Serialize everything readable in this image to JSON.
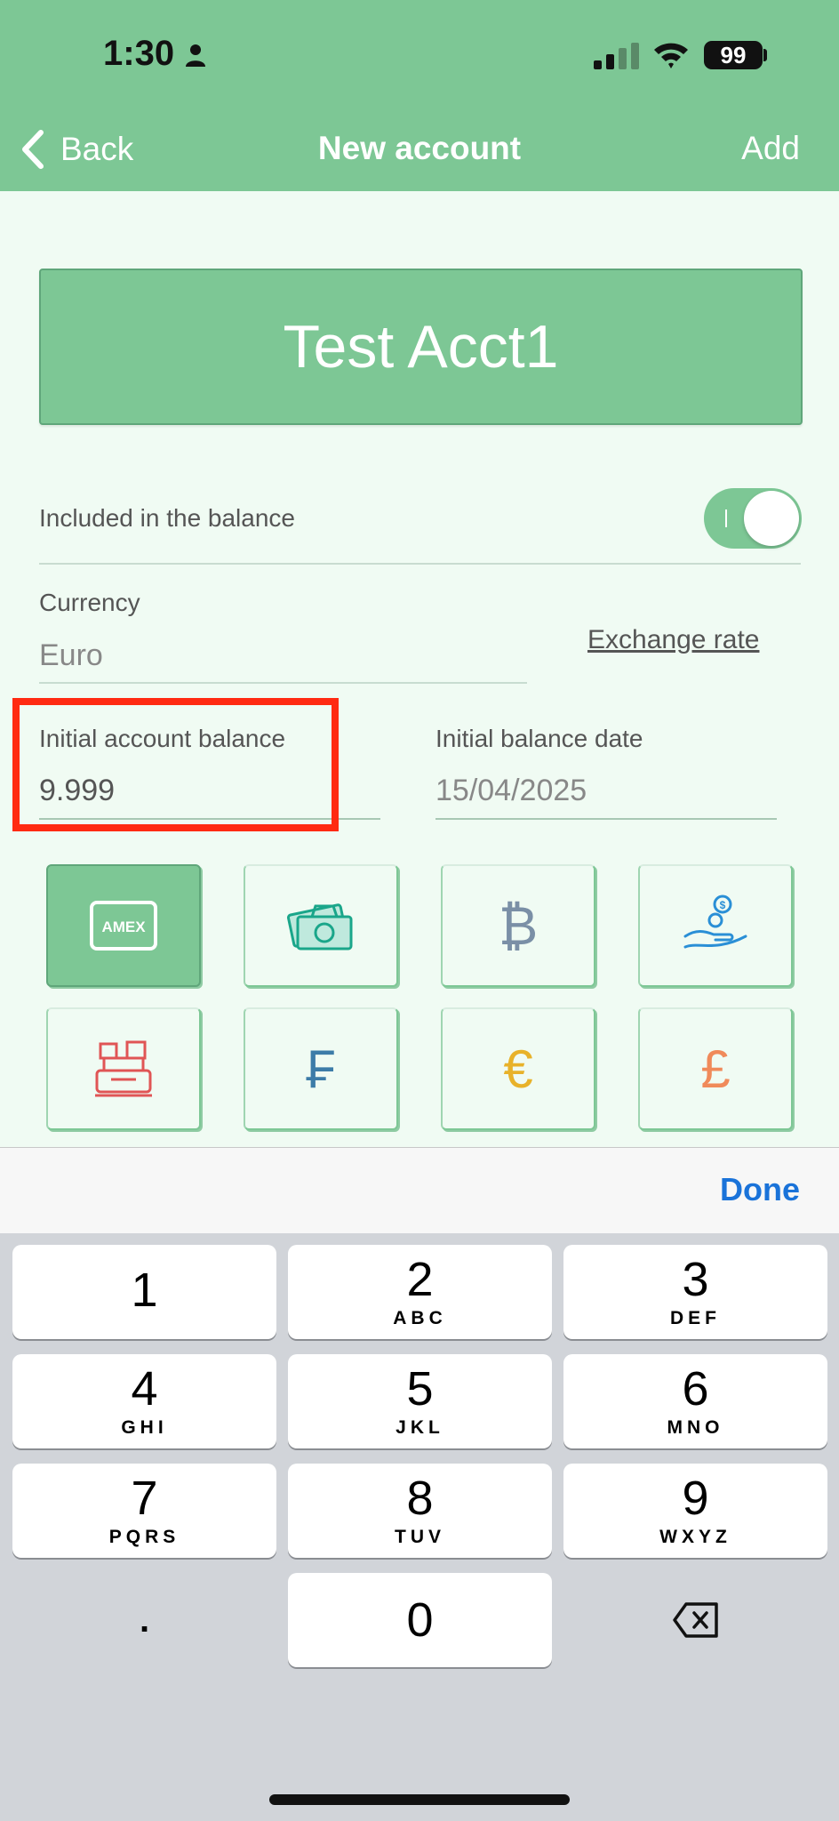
{
  "status_bar": {
    "time": "1:30",
    "battery": "99"
  },
  "nav": {
    "back_label": "Back",
    "title": "New account",
    "add_label": "Add"
  },
  "account_name": "Test Acct1",
  "included_in_balance": {
    "label": "Included in the balance",
    "enabled": true
  },
  "currency": {
    "label": "Currency",
    "value": "Euro",
    "exchange_rate_link": "Exchange rate"
  },
  "initial_balance": {
    "label": "Initial account balance",
    "value": "9.999"
  },
  "initial_date": {
    "label": "Initial balance date",
    "value": "15/04/2025"
  },
  "icons": {
    "row1": [
      "amex-card-icon",
      "cash-banknotes-icon",
      "bitcoin-icon",
      "coin-hand-icon"
    ],
    "row2": [
      "cash-register-icon",
      "franc-icon",
      "euro-icon",
      "pound-icon"
    ],
    "amex_text": "AMEX",
    "bitcoin_glyph": "₿",
    "franc_glyph": "₣",
    "euro_glyph": "€",
    "pound_glyph": "£"
  },
  "keyboard": {
    "done_label": "Done",
    "keys": [
      {
        "num": "1",
        "letters": ""
      },
      {
        "num": "2",
        "letters": "ABC"
      },
      {
        "num": "3",
        "letters": "DEF"
      },
      {
        "num": "4",
        "letters": "GHI"
      },
      {
        "num": "5",
        "letters": "JKL"
      },
      {
        "num": "6",
        "letters": "MNO"
      },
      {
        "num": "7",
        "letters": "PQRS"
      },
      {
        "num": "8",
        "letters": "TUV"
      },
      {
        "num": "9",
        "letters": "WXYZ"
      },
      {
        "num": "0",
        "letters": ""
      }
    ],
    "decimal": "."
  },
  "colors": {
    "accent": "#7dc795",
    "background": "#f0fbf3",
    "highlight": "#ff2a12",
    "link_blue": "#1a73d9"
  }
}
